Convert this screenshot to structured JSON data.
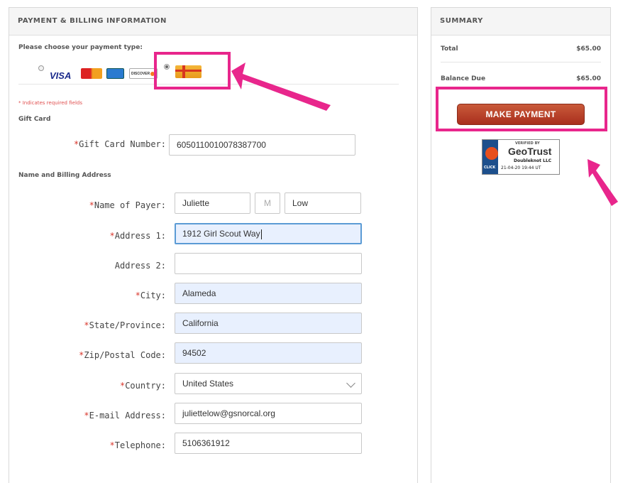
{
  "payment": {
    "header": "PAYMENT & BILLING INFORMATION",
    "choose_label": "Please choose your payment type:",
    "card_icons": [
      "visa-icon",
      "mastercard-icon",
      "amex-icon",
      "discover-icon",
      "gift-card-icon"
    ],
    "card_texts": {
      "visa": "VISA",
      "discover": "DISCOVER"
    },
    "selected_type": "gift-card",
    "required_note": "* Indicates required fields",
    "gift_card_section": "Gift Card",
    "gift_card_label": "Gift Card Number:",
    "gift_card_value": "6050110010078387700",
    "billing_section": "Name and Billing Address"
  },
  "fields": {
    "name_label": "Name of Payer:",
    "first_name": "Juliette",
    "middle_placeholder": "M",
    "last_name": "Low",
    "address1_label": "Address 1:",
    "address1": "1912 Girl Scout Way",
    "address2_label": "Address 2:",
    "address2": "",
    "city_label": "City:",
    "city": "Alameda",
    "state_label": "State/Province:",
    "state": "California",
    "zip_label": "Zip/Postal Code:",
    "zip": "94502",
    "country_label": "Country:",
    "country": "United States",
    "email_label": "E-mail Address:",
    "email": "juliettelow@gsnorcal.org",
    "phone_label": "Telephone:",
    "phone": "5106361912"
  },
  "summary": {
    "header": "SUMMARY",
    "total_label": "Total",
    "total_value": "$65.00",
    "balance_label": "Balance Due",
    "balance_value": "$65.00",
    "button_label": "MAKE PAYMENT"
  },
  "badge": {
    "verified": "VERIFIED BY",
    "brand": "GeoTrust",
    "owner": "Doubleknot LLC",
    "click": "CLICK",
    "stamp": "21-04-20 19:44 UT"
  },
  "colors": {
    "highlight": "#e8268c",
    "button": "#b53d24",
    "required": "#d9362b",
    "autofill": "#e8f0fe"
  }
}
